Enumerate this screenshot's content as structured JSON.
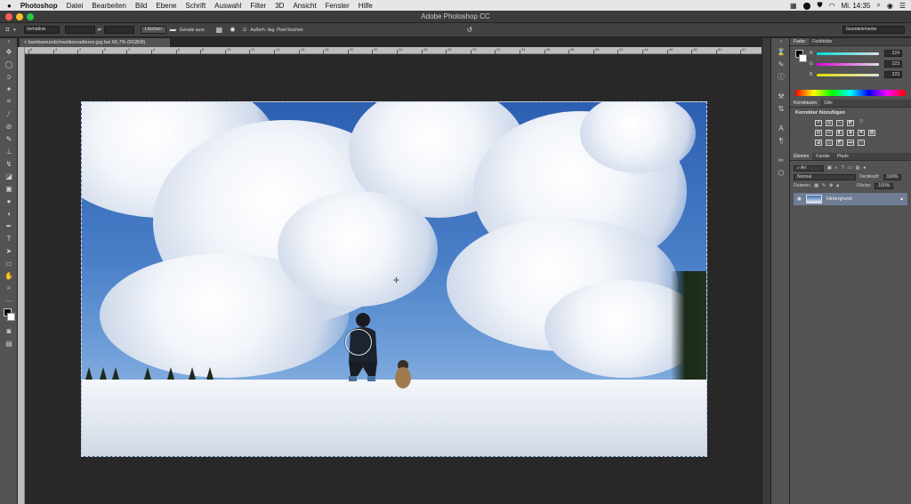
{
  "menubar": {
    "apple": "",
    "items": [
      "Photoshop",
      "Datei",
      "Bearbeiten",
      "Bild",
      "Ebene",
      "Schrift",
      "Auswahl",
      "Filter",
      "3D",
      "Ansicht",
      "Fenster",
      "Hilfe"
    ],
    "clock": "Mi. 14:35"
  },
  "window": {
    "title": "Adobe Photoshop CC"
  },
  "options_bar": {
    "ratio_label": "Verhältnis",
    "clear_button": "Löschen",
    "straighten_label": "Gerade ausr.",
    "delete_pixels_label": "Außerh. lieg. Pixel löschen",
    "workspace": "Grundelemente"
  },
  "document": {
    "tab_title": "bambamundichwolkenradieren.jpg bei 66,7% (RGB/8)"
  },
  "ruler": {
    "labels": [
      "6",
      "4",
      "2",
      "0",
      "2",
      "4",
      "6",
      "8",
      "10",
      "12",
      "14",
      "16",
      "18",
      "20",
      "22",
      "24",
      "26",
      "28",
      "30",
      "32",
      "34",
      "36",
      "38",
      "40",
      "42",
      "44",
      "46",
      "48",
      "50",
      "52"
    ]
  },
  "color_panel": {
    "tabs": [
      "Farbe",
      "Farbfelder"
    ],
    "channels": [
      {
        "label": "R",
        "value": "224",
        "color": "#e05050"
      },
      {
        "label": "G",
        "value": "223",
        "color": "#50c050"
      },
      {
        "label": "B",
        "value": "223",
        "color": "#5080e0"
      }
    ]
  },
  "adjustments_panel": {
    "tabs": [
      "Korrekturen",
      "Stile"
    ],
    "add_label": "Korrektur hinzufügen"
  },
  "layers_panel": {
    "tabs": [
      "Ebenen",
      "Kanäle",
      "Pfade"
    ],
    "filter_label": "Art",
    "blend_mode": "Normal",
    "opacity_label": "Deckkraft:",
    "opacity_value": "100%",
    "lock_label": "Fixieren:",
    "fill_label": "Fläche:",
    "fill_value": "100%",
    "layer_name": "Hintergrund"
  }
}
